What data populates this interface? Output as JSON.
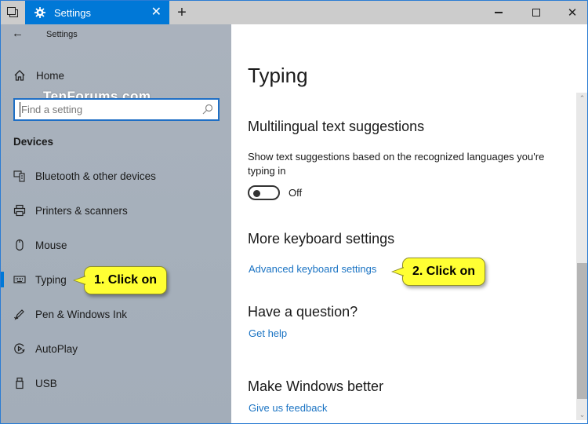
{
  "titlebar": {
    "tab_title": "Settings",
    "new_tab_symbol": "+",
    "close_tab_symbol": "✕",
    "controls": {
      "minimize": "minimize",
      "maximize": "maximize",
      "close": "✕"
    }
  },
  "sidebar": {
    "back_title": "Settings",
    "home_label": "Home",
    "watermark": "TenForums.com",
    "search": {
      "placeholder": "Find a setting",
      "value": ""
    },
    "section_title": "Devices",
    "items": [
      {
        "label": "Bluetooth & other devices",
        "icon": "bluetooth-devices-icon",
        "selected": false
      },
      {
        "label": "Printers & scanners",
        "icon": "printer-icon",
        "selected": false
      },
      {
        "label": "Mouse",
        "icon": "mouse-icon",
        "selected": false
      },
      {
        "label": "Typing",
        "icon": "keyboard-icon",
        "selected": true
      },
      {
        "label": "Pen & Windows Ink",
        "icon": "pen-icon",
        "selected": false
      },
      {
        "label": "AutoPlay",
        "icon": "autoplay-icon",
        "selected": false
      },
      {
        "label": "USB",
        "icon": "usb-icon",
        "selected": false
      }
    ]
  },
  "main": {
    "title": "Typing",
    "multilingual": {
      "heading": "Multilingual text suggestions",
      "description": "Show text suggestions based on the recognized languages you're typing in",
      "toggle_state": "Off"
    },
    "more_keyboard": {
      "heading": "More keyboard settings",
      "link": "Advanced keyboard settings"
    },
    "question": {
      "heading": "Have a question?",
      "link": "Get help"
    },
    "better": {
      "heading": "Make Windows better",
      "link": "Give us feedback"
    }
  },
  "callouts": {
    "step1": "1. Click on",
    "step2": "2. Click on",
    "color": "#ffff33"
  },
  "colors": {
    "accent": "#0078d7",
    "link": "#1a73c3",
    "sidebar_bg": "#a8b1bc"
  }
}
